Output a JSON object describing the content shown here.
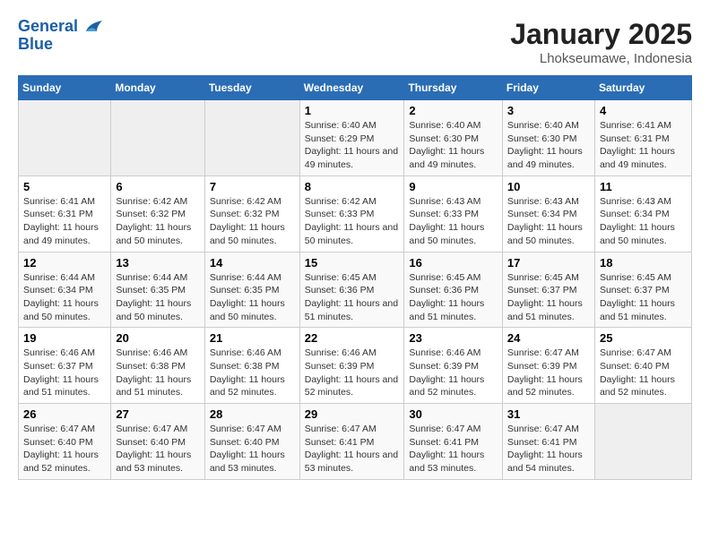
{
  "logo": {
    "line1": "General",
    "line2": "Blue"
  },
  "title": "January 2025",
  "subtitle": "Lhokseumawe, Indonesia",
  "header_days": [
    "Sunday",
    "Monday",
    "Tuesday",
    "Wednesday",
    "Thursday",
    "Friday",
    "Saturday"
  ],
  "weeks": [
    [
      {
        "day": "",
        "empty": true
      },
      {
        "day": "",
        "empty": true
      },
      {
        "day": "",
        "empty": true
      },
      {
        "day": "1",
        "sunrise": "Sunrise: 6:40 AM",
        "sunset": "Sunset: 6:29 PM",
        "daylight": "Daylight: 11 hours and 49 minutes."
      },
      {
        "day": "2",
        "sunrise": "Sunrise: 6:40 AM",
        "sunset": "Sunset: 6:30 PM",
        "daylight": "Daylight: 11 hours and 49 minutes."
      },
      {
        "day": "3",
        "sunrise": "Sunrise: 6:40 AM",
        "sunset": "Sunset: 6:30 PM",
        "daylight": "Daylight: 11 hours and 49 minutes."
      },
      {
        "day": "4",
        "sunrise": "Sunrise: 6:41 AM",
        "sunset": "Sunset: 6:31 PM",
        "daylight": "Daylight: 11 hours and 49 minutes."
      }
    ],
    [
      {
        "day": "5",
        "sunrise": "Sunrise: 6:41 AM",
        "sunset": "Sunset: 6:31 PM",
        "daylight": "Daylight: 11 hours and 49 minutes."
      },
      {
        "day": "6",
        "sunrise": "Sunrise: 6:42 AM",
        "sunset": "Sunset: 6:32 PM",
        "daylight": "Daylight: 11 hours and 50 minutes."
      },
      {
        "day": "7",
        "sunrise": "Sunrise: 6:42 AM",
        "sunset": "Sunset: 6:32 PM",
        "daylight": "Daylight: 11 hours and 50 minutes."
      },
      {
        "day": "8",
        "sunrise": "Sunrise: 6:42 AM",
        "sunset": "Sunset: 6:33 PM",
        "daylight": "Daylight: 11 hours and 50 minutes."
      },
      {
        "day": "9",
        "sunrise": "Sunrise: 6:43 AM",
        "sunset": "Sunset: 6:33 PM",
        "daylight": "Daylight: 11 hours and 50 minutes."
      },
      {
        "day": "10",
        "sunrise": "Sunrise: 6:43 AM",
        "sunset": "Sunset: 6:34 PM",
        "daylight": "Daylight: 11 hours and 50 minutes."
      },
      {
        "day": "11",
        "sunrise": "Sunrise: 6:43 AM",
        "sunset": "Sunset: 6:34 PM",
        "daylight": "Daylight: 11 hours and 50 minutes."
      }
    ],
    [
      {
        "day": "12",
        "sunrise": "Sunrise: 6:44 AM",
        "sunset": "Sunset: 6:34 PM",
        "daylight": "Daylight: 11 hours and 50 minutes."
      },
      {
        "day": "13",
        "sunrise": "Sunrise: 6:44 AM",
        "sunset": "Sunset: 6:35 PM",
        "daylight": "Daylight: 11 hours and 50 minutes."
      },
      {
        "day": "14",
        "sunrise": "Sunrise: 6:44 AM",
        "sunset": "Sunset: 6:35 PM",
        "daylight": "Daylight: 11 hours and 50 minutes."
      },
      {
        "day": "15",
        "sunrise": "Sunrise: 6:45 AM",
        "sunset": "Sunset: 6:36 PM",
        "daylight": "Daylight: 11 hours and 51 minutes."
      },
      {
        "day": "16",
        "sunrise": "Sunrise: 6:45 AM",
        "sunset": "Sunset: 6:36 PM",
        "daylight": "Daylight: 11 hours and 51 minutes."
      },
      {
        "day": "17",
        "sunrise": "Sunrise: 6:45 AM",
        "sunset": "Sunset: 6:37 PM",
        "daylight": "Daylight: 11 hours and 51 minutes."
      },
      {
        "day": "18",
        "sunrise": "Sunrise: 6:45 AM",
        "sunset": "Sunset: 6:37 PM",
        "daylight": "Daylight: 11 hours and 51 minutes."
      }
    ],
    [
      {
        "day": "19",
        "sunrise": "Sunrise: 6:46 AM",
        "sunset": "Sunset: 6:37 PM",
        "daylight": "Daylight: 11 hours and 51 minutes."
      },
      {
        "day": "20",
        "sunrise": "Sunrise: 6:46 AM",
        "sunset": "Sunset: 6:38 PM",
        "daylight": "Daylight: 11 hours and 51 minutes."
      },
      {
        "day": "21",
        "sunrise": "Sunrise: 6:46 AM",
        "sunset": "Sunset: 6:38 PM",
        "daylight": "Daylight: 11 hours and 52 minutes."
      },
      {
        "day": "22",
        "sunrise": "Sunrise: 6:46 AM",
        "sunset": "Sunset: 6:39 PM",
        "daylight": "Daylight: 11 hours and 52 minutes."
      },
      {
        "day": "23",
        "sunrise": "Sunrise: 6:46 AM",
        "sunset": "Sunset: 6:39 PM",
        "daylight": "Daylight: 11 hours and 52 minutes."
      },
      {
        "day": "24",
        "sunrise": "Sunrise: 6:47 AM",
        "sunset": "Sunset: 6:39 PM",
        "daylight": "Daylight: 11 hours and 52 minutes."
      },
      {
        "day": "25",
        "sunrise": "Sunrise: 6:47 AM",
        "sunset": "Sunset: 6:40 PM",
        "daylight": "Daylight: 11 hours and 52 minutes."
      }
    ],
    [
      {
        "day": "26",
        "sunrise": "Sunrise: 6:47 AM",
        "sunset": "Sunset: 6:40 PM",
        "daylight": "Daylight: 11 hours and 52 minutes."
      },
      {
        "day": "27",
        "sunrise": "Sunrise: 6:47 AM",
        "sunset": "Sunset: 6:40 PM",
        "daylight": "Daylight: 11 hours and 53 minutes."
      },
      {
        "day": "28",
        "sunrise": "Sunrise: 6:47 AM",
        "sunset": "Sunset: 6:40 PM",
        "daylight": "Daylight: 11 hours and 53 minutes."
      },
      {
        "day": "29",
        "sunrise": "Sunrise: 6:47 AM",
        "sunset": "Sunset: 6:41 PM",
        "daylight": "Daylight: 11 hours and 53 minutes."
      },
      {
        "day": "30",
        "sunrise": "Sunrise: 6:47 AM",
        "sunset": "Sunset: 6:41 PM",
        "daylight": "Daylight: 11 hours and 53 minutes."
      },
      {
        "day": "31",
        "sunrise": "Sunrise: 6:47 AM",
        "sunset": "Sunset: 6:41 PM",
        "daylight": "Daylight: 11 hours and 54 minutes."
      },
      {
        "day": "",
        "empty": true
      }
    ]
  ]
}
